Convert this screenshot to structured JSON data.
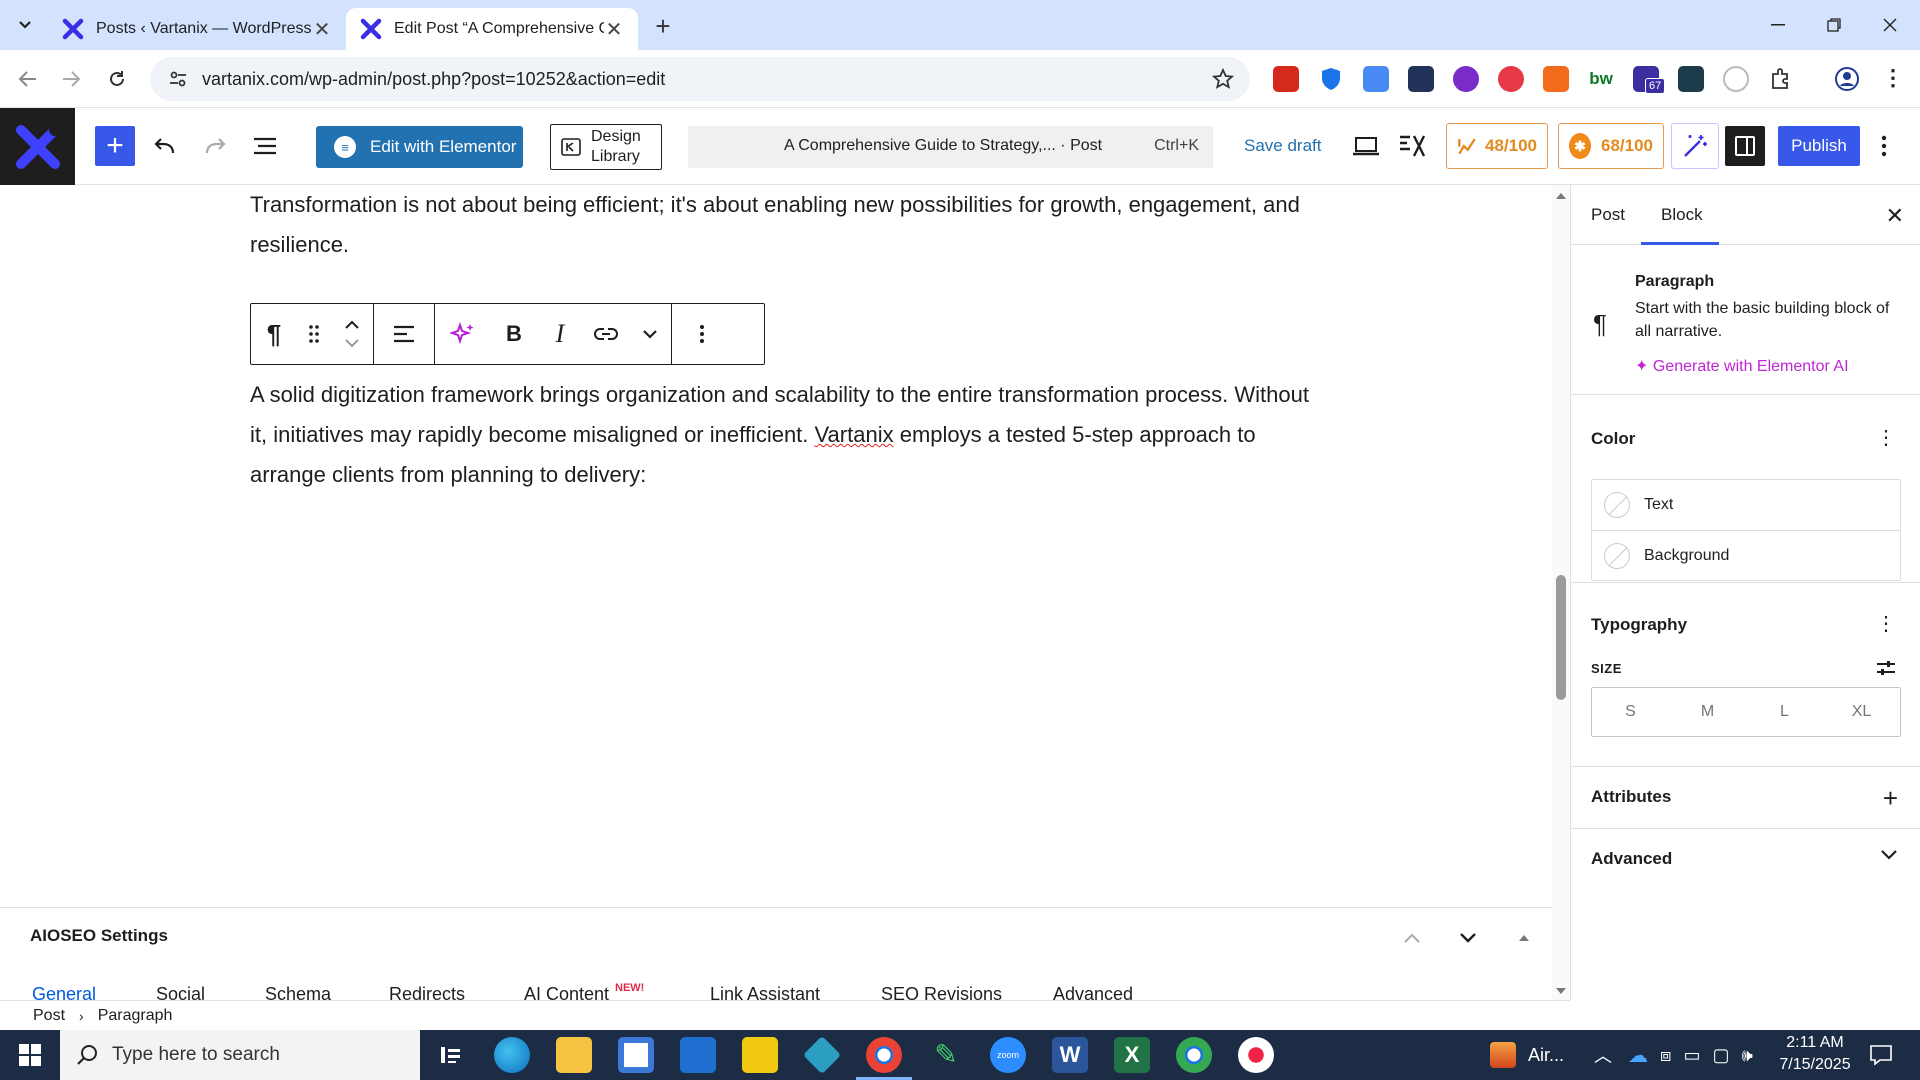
{
  "browser": {
    "tabs": [
      {
        "title": "Posts ‹ Vartanix — WordPress",
        "active": false
      },
      {
        "title": "Edit Post “A Comprehensive Gu",
        "active": true
      }
    ],
    "url": "vartanix.com/wp-admin/post.php?post=10252&action=edit",
    "extension_badge": "67"
  },
  "editor_header": {
    "edit_elementor_label": "Edit with Elementor",
    "design_library_line1": "Design",
    "design_library_line2": "Library",
    "document_title": "A Comprehensive Guide to Strategy,... · Post",
    "command_shortcut": "Ctrl+K",
    "save_draft_label": "Save draft",
    "seo_score": "48/100",
    "truseo_score": "68/100",
    "publish_label": "Publish"
  },
  "content": {
    "paragraph1": "Transformation is not about being efficient; it's about enabling new possibilities for growth, engagement, and resilience.",
    "paragraph2_part1": "A solid digitization framework brings organization and scalability to the entire transformation process. Without it, initiatives may rapidly become misaligned or inefficient. ",
    "paragraph2_spell": "Vartanix",
    "paragraph2_part2": " employs a tested 5-step approach to arrange clients from planning to delivery:"
  },
  "sidebar": {
    "tabs": [
      "Post",
      "Block"
    ],
    "active_tab": "Block",
    "block": {
      "name": "Paragraph",
      "description": "Start with the basic building block of all narrative.",
      "generate_label": "Generate with Elementor AI"
    },
    "color": {
      "title": "Color",
      "items": [
        "Text",
        "Background"
      ]
    },
    "typography": {
      "title": "Typography",
      "size_label": "SIZE",
      "sizes": [
        "S",
        "M",
        "L",
        "XL"
      ]
    },
    "attributes_title": "Attributes",
    "advanced_title": "Advanced"
  },
  "aioseo": {
    "title": "AIOSEO Settings",
    "tabs": [
      "General",
      "Social",
      "Schema",
      "Redirects",
      "AI Content",
      "Link Assistant",
      "SEO Revisions",
      "Advanced"
    ],
    "active_tab": "General",
    "new_badge": "NEW!"
  },
  "breadcrumb": [
    "Post",
    "Paragraph"
  ],
  "taskbar": {
    "search_placeholder": "Type here to search",
    "weather": "Air...",
    "time": "2:11 AM",
    "date": "7/15/2025"
  },
  "colors": {
    "wp_blue": "#3858e9",
    "elementor_blue": "#2271b1",
    "seo_orange": "#e38a1f",
    "ai_purple": "#c026d3",
    "chrome_tabbar": "#d3e3fd",
    "taskbar": "#1c2c44"
  }
}
